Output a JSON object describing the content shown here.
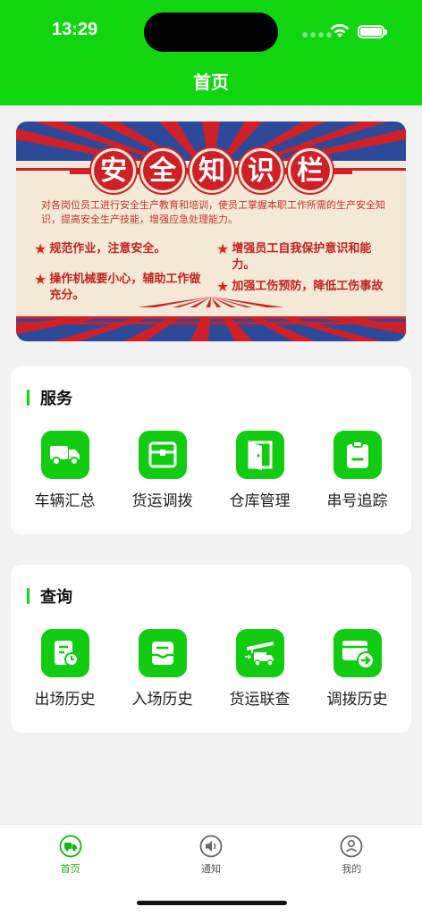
{
  "status": {
    "time": "13:29"
  },
  "nav": {
    "title": "首页"
  },
  "banner": {
    "title_chars": [
      "安",
      "全",
      "知",
      "识",
      "栏"
    ],
    "intro": "对各岗位员工进行安全生产教育和培训，使员工掌握本职工作所需的生产安全知识，提高安全生产技能，增强应急处理能力。",
    "slogans": [
      "规范作业，注意安全。",
      "操作机械要小心，辅助工作做充分。",
      "增强员工自我保护意识和能力。",
      "加强工伤预防，降低工伤事故"
    ],
    "colors": {
      "red": "#cf2027",
      "blue": "#2d4a9a",
      "cream": "#f3e9d6"
    }
  },
  "services": {
    "title": "服务",
    "items": [
      {
        "label": "车辆汇总",
        "icon": "truck-icon"
      },
      {
        "label": "货运调拨",
        "icon": "box-icon"
      },
      {
        "label": "仓库管理",
        "icon": "door-icon"
      },
      {
        "label": "串号追踪",
        "icon": "clipboard-icon"
      }
    ]
  },
  "query": {
    "title": "查询",
    "items": [
      {
        "label": "出场历史",
        "icon": "document-clock-icon"
      },
      {
        "label": "入场历史",
        "icon": "inbox-icon"
      },
      {
        "label": "货运联查",
        "icon": "crane-truck-icon"
      },
      {
        "label": "调拨历史",
        "icon": "card-arrow-icon"
      }
    ]
  },
  "tabs": [
    {
      "label": "首页",
      "icon": "truck-icon",
      "active": true
    },
    {
      "label": "通知",
      "icon": "speaker-icon",
      "active": false
    },
    {
      "label": "我的",
      "icon": "user-icon",
      "active": false
    }
  ],
  "theme": {
    "accent": "#0fd60f"
  }
}
